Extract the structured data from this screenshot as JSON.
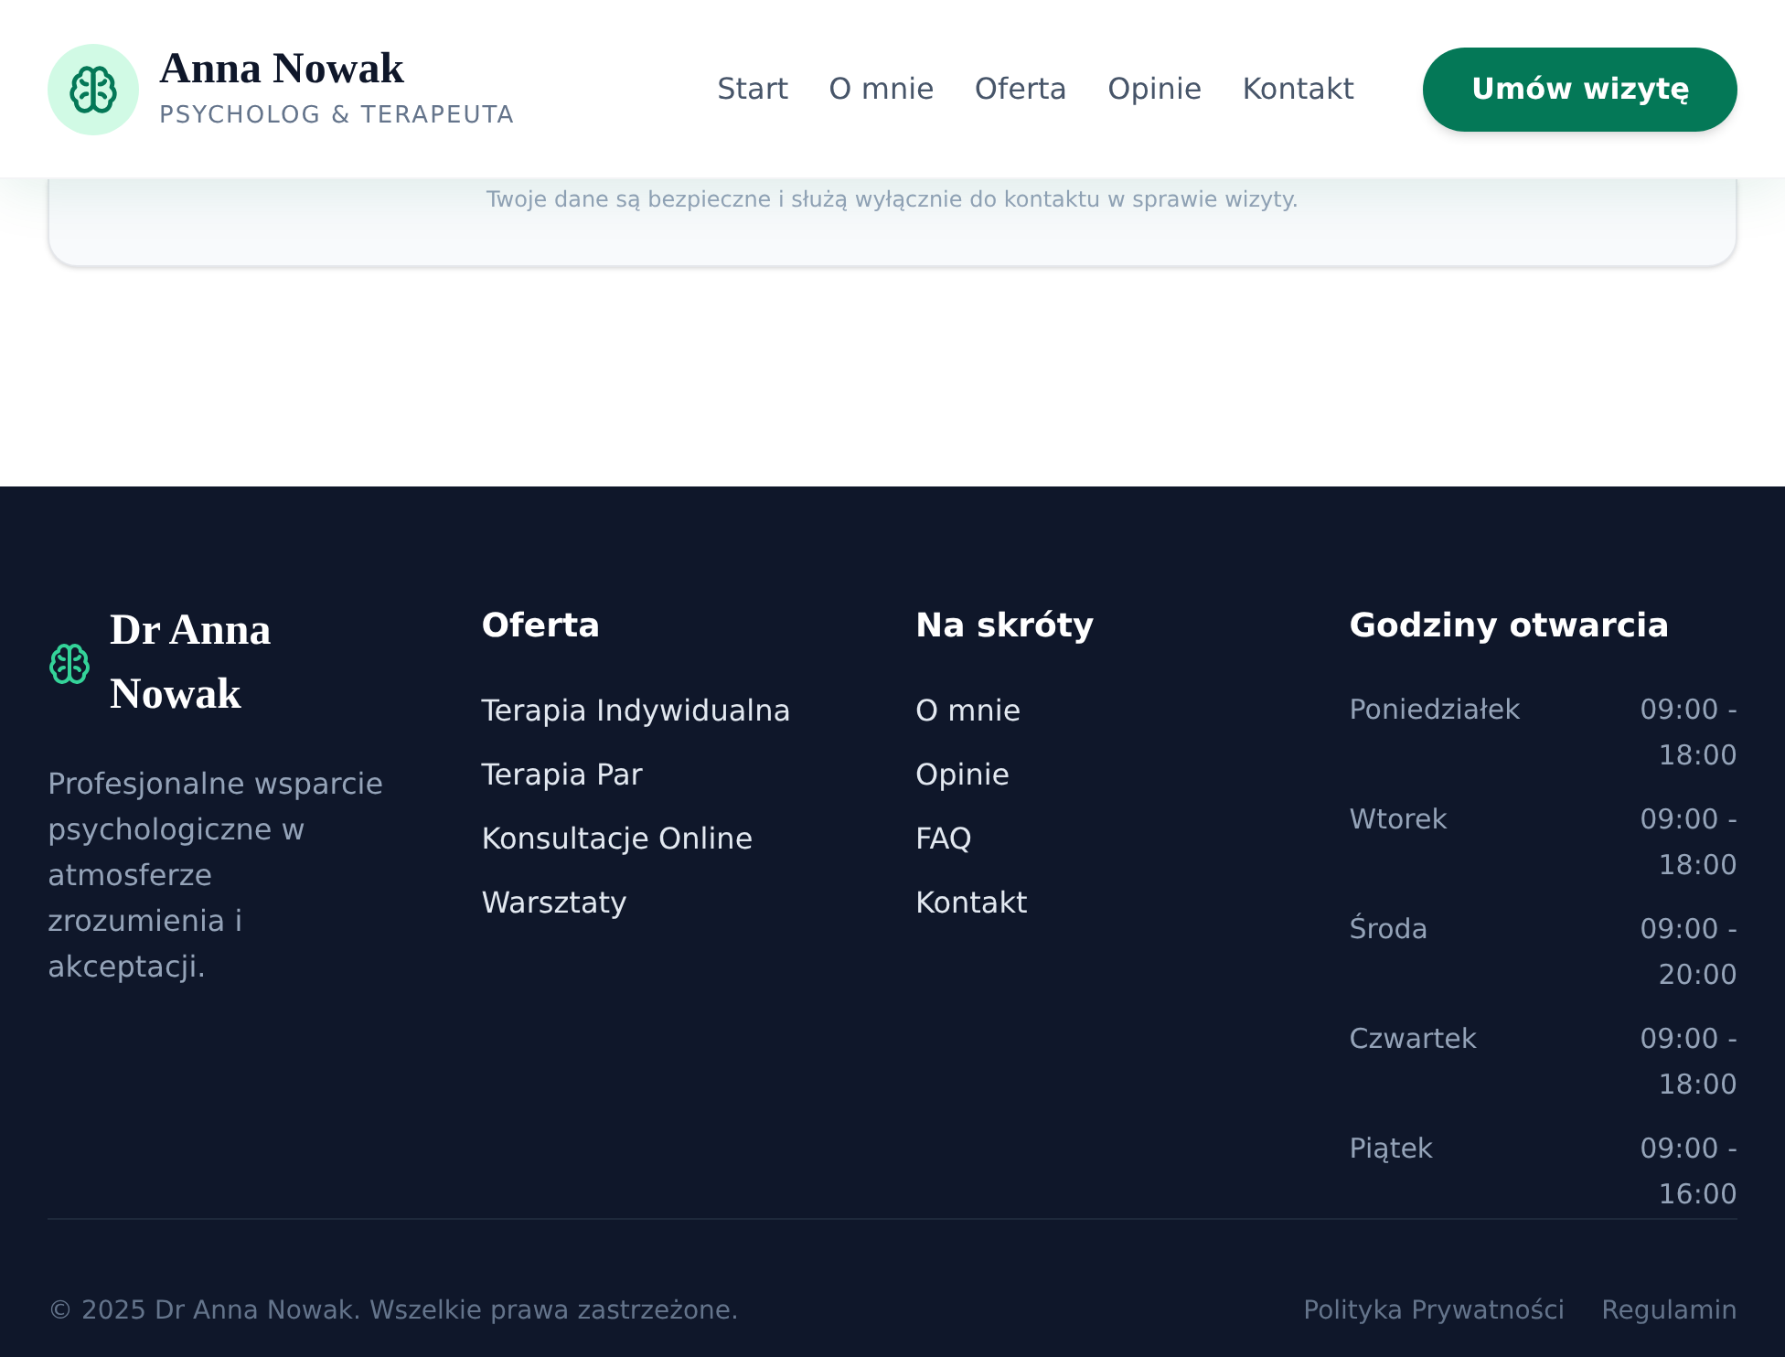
{
  "header": {
    "name": "Anna Nowak",
    "subtitle": "PSYCHOLOG & TERAPEUTA",
    "nav": [
      {
        "label": "Start"
      },
      {
        "label": "O mnie"
      },
      {
        "label": "Oferta"
      },
      {
        "label": "Opinie"
      },
      {
        "label": "Kontakt"
      }
    ],
    "cta": "Umów wizytę"
  },
  "form_card": {
    "note": "Twoje dane są bezpieczne i służą wyłącznie do kontaktu w sprawie wizyty."
  },
  "footer": {
    "brand": "Dr Anna Nowak",
    "description": "Profesjonalne wsparcie psychologiczne w atmosferze zrozumienia i akceptacji.",
    "columns": [
      {
        "title": "Oferta",
        "links": [
          "Terapia Indywidualna",
          "Terapia Par",
          "Konsultacje Online",
          "Warsztaty"
        ]
      },
      {
        "title": "Na skróty",
        "links": [
          "O mnie",
          "Opinie",
          "FAQ",
          "Kontakt"
        ]
      }
    ],
    "hours": {
      "title": "Godziny otwarcia",
      "rows": [
        {
          "day": "Poniedziałek",
          "time": "09:00 - 18:00"
        },
        {
          "day": "Wtorek",
          "time": "09:00 - 18:00"
        },
        {
          "day": "Środa",
          "time": "09:00 - 20:00"
        },
        {
          "day": "Czwartek",
          "time": "09:00 - 18:00"
        },
        {
          "day": "Piątek",
          "time": "09:00 - 16:00"
        }
      ]
    },
    "copyright": "© 2025 Dr Anna Nowak. Wszelkie prawa zastrzeżone.",
    "legal_links": [
      "Polityka Prywatności",
      "Regulamin"
    ]
  }
}
